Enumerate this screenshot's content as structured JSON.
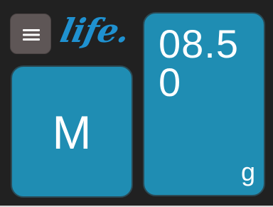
{
  "header": {
    "menu_icon": "hamburger-menu-icon",
    "logo_text": "life."
  },
  "mode": {
    "label": "M"
  },
  "scale": {
    "weight_value": "08.50",
    "unit": "g"
  },
  "colors": {
    "background": "#212121",
    "tile": "#1f8db3",
    "menu_button": "#5e5656",
    "logo": "#1f91d0",
    "text": "#ffffff"
  }
}
